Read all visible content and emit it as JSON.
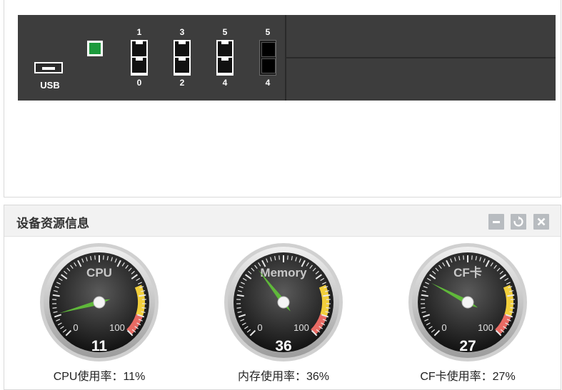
{
  "device": {
    "usb_label": "USB",
    "ports": [
      {
        "top": "1",
        "bottom": "0",
        "style": "white"
      },
      {
        "top": "3",
        "bottom": "2",
        "style": "white"
      },
      {
        "top": "5",
        "bottom": "4",
        "style": "white"
      },
      {
        "top": "5",
        "bottom": "4",
        "style": "dark"
      }
    ]
  },
  "resource_panel": {
    "title": "设备资源信息",
    "buttons": [
      "minimize-icon",
      "refresh-icon",
      "close-icon"
    ],
    "gauges": [
      {
        "label": "CPU",
        "value": 11,
        "min_label": "0",
        "max_label": "100",
        "caption": "CPU使用率：11%"
      },
      {
        "label": "Memory",
        "value": 36,
        "min_label": "0",
        "max_label": "100",
        "caption": "内存使用率：36%"
      },
      {
        "label": "CF卡",
        "value": 27,
        "min_label": "0",
        "max_label": "100",
        "caption": "CF卡使用率：27%"
      }
    ]
  },
  "colors": {
    "chassis": "#3d3d3d",
    "led_green": "#1c9a3c",
    "needle_green": "#5fb83a",
    "band_yellow": "#f2cf3b",
    "band_red": "#e86a63"
  }
}
